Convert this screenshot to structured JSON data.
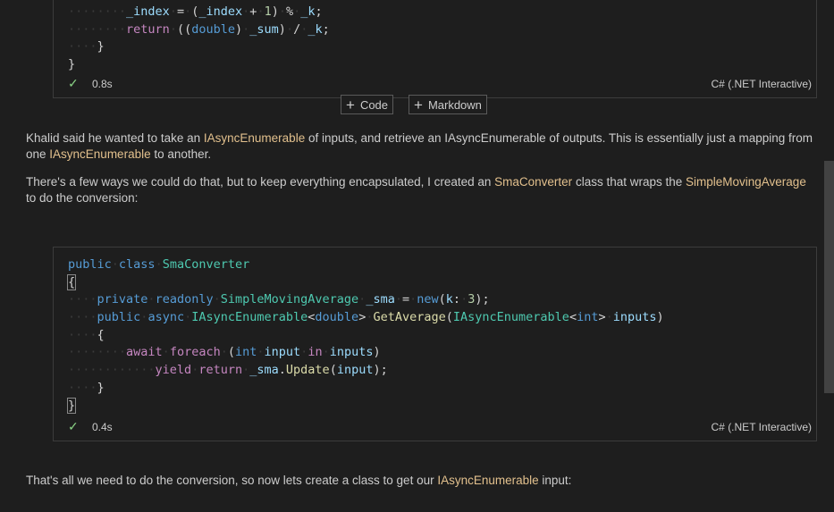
{
  "cells": [
    {
      "lines": [
        [
          [
            "ws",
            "········"
          ],
          [
            "var",
            "_index"
          ],
          [
            "ws",
            "·"
          ],
          [
            "p",
            "="
          ],
          [
            "ws",
            "·"
          ],
          [
            "p",
            "("
          ],
          [
            "var",
            "_index"
          ],
          [
            "ws",
            "·"
          ],
          [
            "p",
            "+"
          ],
          [
            "ws",
            "·"
          ],
          [
            "num",
            "1"
          ],
          [
            "p",
            ")"
          ],
          [
            "ws",
            "·"
          ],
          [
            "p",
            "%"
          ],
          [
            "ws",
            "·"
          ],
          [
            "var",
            "_k"
          ],
          [
            "p",
            ";"
          ]
        ],
        [
          [
            "ws",
            "········"
          ],
          [
            "ctl",
            "return"
          ],
          [
            "ws",
            "·"
          ],
          [
            "p",
            "(("
          ],
          [
            "kw",
            "double"
          ],
          [
            "p",
            ")"
          ],
          [
            "ws",
            "·"
          ],
          [
            "var",
            "_sum"
          ],
          [
            "p",
            ")"
          ],
          [
            "ws",
            "·"
          ],
          [
            "p",
            "/"
          ],
          [
            "ws",
            "·"
          ],
          [
            "var",
            "_k"
          ],
          [
            "p",
            ";"
          ]
        ],
        [
          [
            "ws",
            "····"
          ],
          [
            "p",
            "}"
          ]
        ],
        [
          [
            "p",
            "}"
          ]
        ]
      ],
      "status": {
        "check": "✓",
        "time": "0.8s",
        "kernel": "C# (.NET Interactive)"
      }
    },
    {
      "lines": [
        [
          [
            "kw",
            "public"
          ],
          [
            "ws",
            "·"
          ],
          [
            "kw",
            "class"
          ],
          [
            "ws",
            "·"
          ],
          [
            "ty",
            "SmaConverter"
          ]
        ],
        [
          [
            "bh",
            "{"
          ]
        ],
        [
          [
            "ws",
            "····"
          ],
          [
            "kw",
            "private"
          ],
          [
            "ws",
            "·"
          ],
          [
            "kw",
            "readonly"
          ],
          [
            "ws",
            "·"
          ],
          [
            "ty",
            "SimpleMovingAverage"
          ],
          [
            "ws",
            "·"
          ],
          [
            "var",
            "_sma"
          ],
          [
            "ws",
            "·"
          ],
          [
            "p",
            "="
          ],
          [
            "ws",
            "·"
          ],
          [
            "kw",
            "new"
          ],
          [
            "p",
            "("
          ],
          [
            "var",
            "k"
          ],
          [
            "p",
            ":"
          ],
          [
            "ws",
            "·"
          ],
          [
            "num",
            "3"
          ],
          [
            "p",
            ");"
          ]
        ],
        [
          [
            "ws",
            "····"
          ],
          [
            "kw",
            "public"
          ],
          [
            "ws",
            "·"
          ],
          [
            "kw",
            "async"
          ],
          [
            "ws",
            "·"
          ],
          [
            "ty",
            "IAsyncEnumerable"
          ],
          [
            "p",
            "<"
          ],
          [
            "kw",
            "double"
          ],
          [
            "p",
            ">"
          ],
          [
            "ws",
            "·"
          ],
          [
            "fn",
            "GetAverage"
          ],
          [
            "p",
            "("
          ],
          [
            "ty",
            "IAsyncEnumerable"
          ],
          [
            "p",
            "<"
          ],
          [
            "kw",
            "int"
          ],
          [
            "p",
            ">"
          ],
          [
            "ws",
            "·"
          ],
          [
            "var",
            "inputs"
          ],
          [
            "p",
            ")"
          ]
        ],
        [
          [
            "ws",
            "····"
          ],
          [
            "p",
            "{"
          ]
        ],
        [
          [
            "ws",
            "········"
          ],
          [
            "ctl",
            "await"
          ],
          [
            "ws",
            "·"
          ],
          [
            "ctl",
            "foreach"
          ],
          [
            "ws",
            "·"
          ],
          [
            "p",
            "("
          ],
          [
            "kw",
            "int"
          ],
          [
            "ws",
            "·"
          ],
          [
            "var",
            "input"
          ],
          [
            "ws",
            "·"
          ],
          [
            "ctl",
            "in"
          ],
          [
            "ws",
            "·"
          ],
          [
            "var",
            "inputs"
          ],
          [
            "p",
            ")"
          ]
        ],
        [
          [
            "ws",
            "············"
          ],
          [
            "ctl",
            "yield"
          ],
          [
            "ws",
            "·"
          ],
          [
            "ctl",
            "return"
          ],
          [
            "ws",
            "·"
          ],
          [
            "var",
            "_sma"
          ],
          [
            "p",
            "."
          ],
          [
            "fn",
            "Update"
          ],
          [
            "p",
            "("
          ],
          [
            "var",
            "input"
          ],
          [
            "p",
            ");"
          ]
        ],
        [
          [
            "ws",
            "····"
          ],
          [
            "p",
            "}"
          ]
        ],
        [
          [
            "bh",
            "}"
          ]
        ]
      ],
      "status": {
        "check": "✓",
        "time": "0.4s",
        "kernel": "C# (.NET Interactive)"
      }
    }
  ],
  "add_buttons": {
    "code_label": "Code",
    "markdown_label": "Markdown",
    "plus": "+"
  },
  "markdown": {
    "p1": [
      [
        "t",
        "Khalid said he wanted to take an "
      ],
      [
        "h",
        "IAsyncEnumerable"
      ],
      [
        "t",
        " of inputs, and retrieve an IAsyncEnumerable of outputs. This is essentially just a mapping from one "
      ],
      [
        "h",
        "IAsyncEnumerable"
      ],
      [
        "t",
        " to another."
      ]
    ],
    "p2": [
      [
        "t",
        "There's a few ways we could do that, but to keep everything encapsulated, I created an "
      ],
      [
        "h",
        "SmaConverter"
      ],
      [
        "t",
        " class that wraps the "
      ],
      [
        "h",
        "SimpleMovingAverage"
      ],
      [
        "t",
        " to do the conversion:"
      ]
    ],
    "p3": [
      [
        "t",
        "That's all we need to do the conversion, so now lets create a class to get our "
      ],
      [
        "h",
        "IAsyncEnumerable"
      ],
      [
        "t",
        " input:"
      ]
    ]
  }
}
